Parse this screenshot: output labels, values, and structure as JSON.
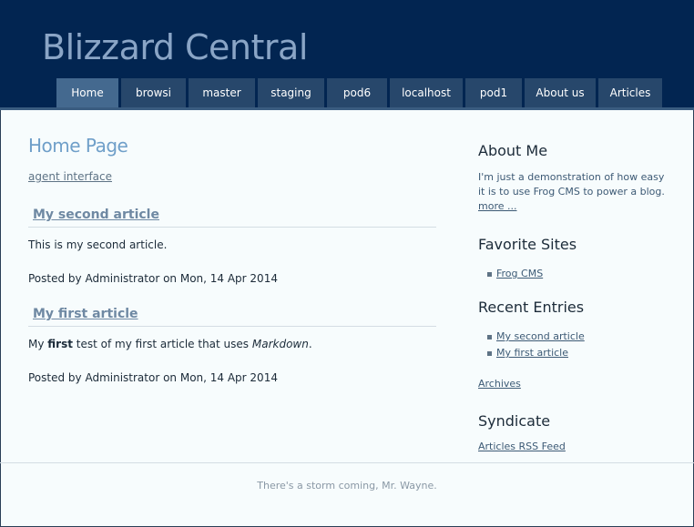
{
  "site": {
    "title": "Blizzard Central"
  },
  "nav": [
    {
      "label": "Home",
      "active": true
    },
    {
      "label": "browsi"
    },
    {
      "label": "master"
    },
    {
      "label": "staging"
    },
    {
      "label": "pod6"
    },
    {
      "label": "localhost"
    },
    {
      "label": "pod1"
    },
    {
      "label": "About us"
    },
    {
      "label": "Articles"
    }
  ],
  "main": {
    "title": "Home Page",
    "agent_link": "agent interface",
    "articles": [
      {
        "title": "My second article",
        "body": "This is my second article.",
        "posted": "Posted by Administrator on Mon, 14 Apr 2014"
      },
      {
        "title": "My first article",
        "body_parts": [
          "My ",
          "first",
          " test of my first article that uses ",
          "Markdown",
          "."
        ],
        "posted": "Posted by Administrator on Mon, 14 Apr 2014"
      }
    ]
  },
  "sidebar": {
    "about": {
      "heading": "About Me",
      "text": "I'm just a demonstration of how easy it is to use Frog CMS to power a blog.",
      "more": "more ..."
    },
    "favorites": {
      "heading": "Favorite Sites",
      "items": [
        "Frog CMS"
      ]
    },
    "recent": {
      "heading": "Recent Entries",
      "items": [
        "My second article",
        "My first article"
      ]
    },
    "archives": "Archives",
    "syndicate": {
      "heading": "Syndicate",
      "link": "Articles RSS Feed"
    }
  },
  "footer": {
    "text": "There's a storm coming, Mr. Wayne."
  },
  "colors": {
    "header_bg": "#022551",
    "tab_bg": "#27476b",
    "tab_active_bg": "#44698f",
    "page_title": "#6f9fc9"
  }
}
